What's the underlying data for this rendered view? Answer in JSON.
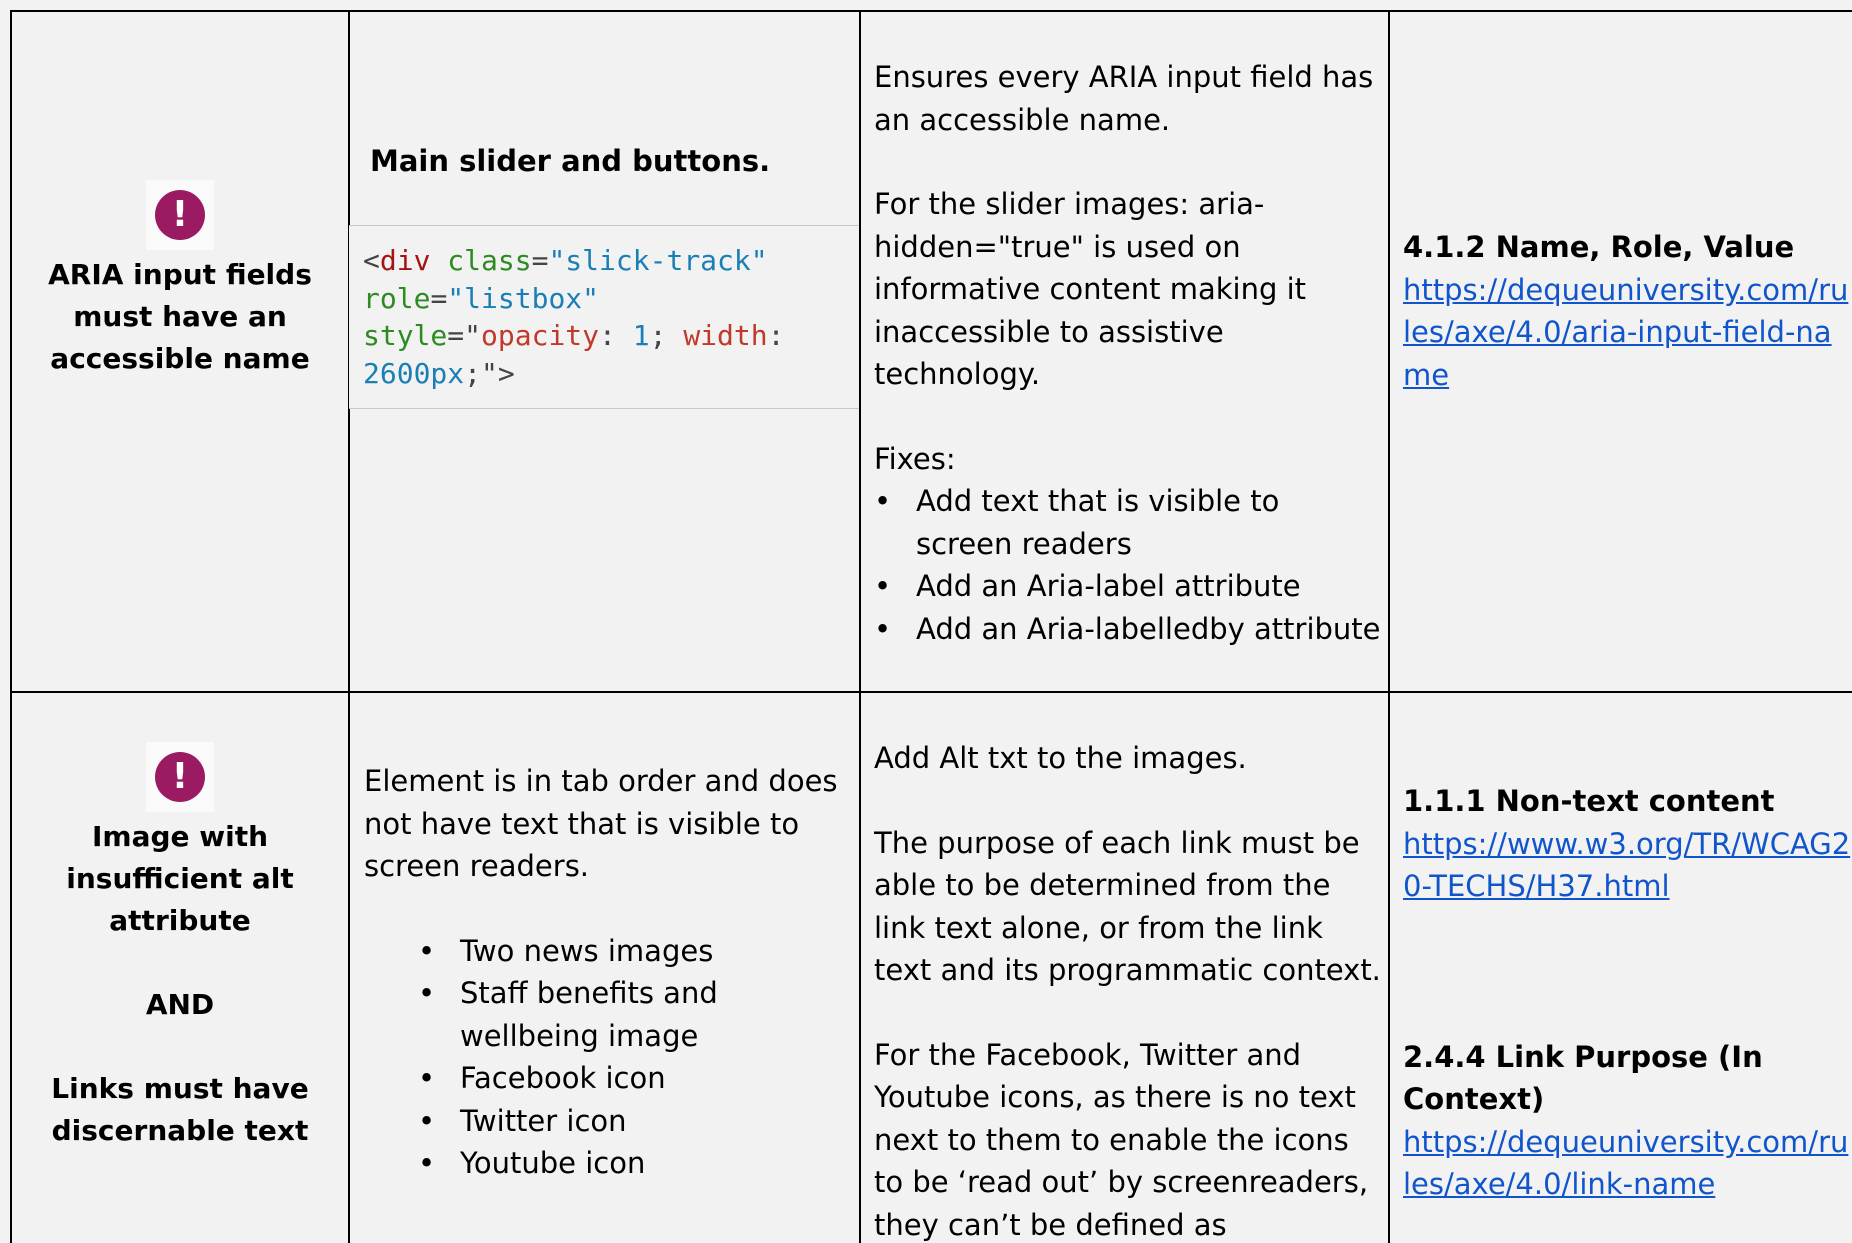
{
  "rows": [
    {
      "issue_icon": "exclamation-circle-icon",
      "issue_title": "ARIA input fields must have an accessible name",
      "location_heading": "Main slider and buttons.",
      "code": {
        "t1": "<div",
        "t2": "class",
        "t3": "=",
        "t4": "\"slick-track\"",
        "t5": "role",
        "t6": "=",
        "t7": "\"listbox\"",
        "t8": "style",
        "t9": "=\"",
        "t10": "opacity",
        "t11": ": ",
        "t12": "1",
        "t13": "; ",
        "t14": "width",
        "t15": ":",
        "t16": "2600px",
        "t17": ";\">"
      },
      "description": [
        "Ensures every ARIA input field has an accessible name.",
        "For the slider images: aria-hidden=\"true\" is used on informative content making it inaccessible to assistive technology.",
        "Fixes:"
      ],
      "fixes": [
        "Add text that is visible to screen readers",
        "Add an Aria-label attribute",
        "Add an Aria-labelledby attribute"
      ],
      "guideline_title": "4.1.2 Name, Role, Value",
      "guideline_link": "https://dequeuniversity.com/rules/axe/4.0/aria-input-field-name"
    },
    {
      "issue_icon": "exclamation-circle-icon",
      "issue_title_1": "Image with insufficient alt attribute",
      "issue_and": "AND",
      "issue_title_2": "Links must have discernable text",
      "location_text": "Element is in tab order and does not have text that is visible to screen readers.",
      "items": [
        "Two news images",
        "Staff benefits and wellbeing image",
        "Facebook icon",
        "Twitter icon",
        "Youtube icon"
      ],
      "description": [
        "Add Alt txt to the images.",
        "The purpose of each link must be able to be determined from the link text alone, or from the link text and its programmatic context.",
        "For the Facebook, Twitter and Youtube icons, as there is no text next to them to enable the icons to be ‘read out’ by screenreaders, they can’t be defined as decorative,"
      ],
      "guideline_1_title": "1.1.1 Non-text content",
      "guideline_1_link": "https://www.w3.org/TR/WCAG20-TECHS/H37.html",
      "guideline_2_title": "2.4.4 Link Purpose (In Context)",
      "guideline_2_link": "https://dequeuniversity.com/rules/axe/4.0/link-name"
    }
  ]
}
